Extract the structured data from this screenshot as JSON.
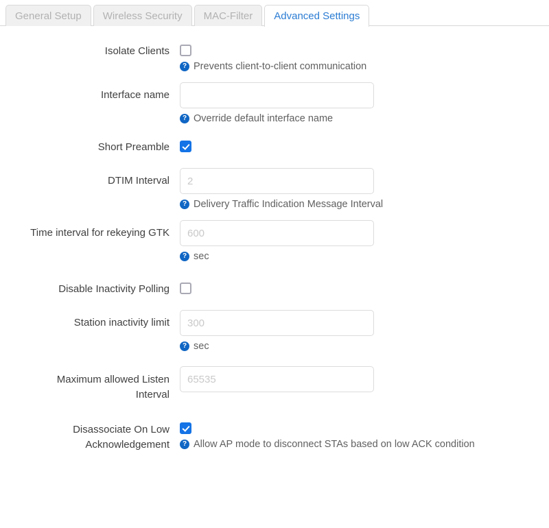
{
  "tabs": [
    {
      "label": "General Setup",
      "active": false
    },
    {
      "label": "Wireless Security",
      "active": false
    },
    {
      "label": "MAC-Filter",
      "active": false
    },
    {
      "label": "Advanced Settings",
      "active": true
    }
  ],
  "help_icon_glyph": "?",
  "fields": {
    "isolate_clients": {
      "label": "Isolate Clients",
      "checked": false,
      "help": "Prevents client-to-client communication"
    },
    "interface_name": {
      "label": "Interface name",
      "value": "",
      "placeholder": "",
      "help": "Override default interface name"
    },
    "short_preamble": {
      "label": "Short Preamble",
      "checked": true,
      "help": ""
    },
    "dtim_interval": {
      "label": "DTIM Interval",
      "value": "",
      "placeholder": "2",
      "help": "Delivery Traffic Indication Message Interval"
    },
    "rekey_gtk": {
      "label": "Time interval for rekeying GTK",
      "value": "",
      "placeholder": "600",
      "help": "sec"
    },
    "disable_inactivity_polling": {
      "label": "Disable Inactivity Polling",
      "checked": false,
      "help": ""
    },
    "station_inactivity_limit": {
      "label": "Station inactivity limit",
      "value": "",
      "placeholder": "300",
      "help": "sec"
    },
    "max_listen_interval": {
      "label_line1": "Maximum allowed Listen",
      "label_line2": "Interval",
      "value": "",
      "placeholder": "65535",
      "help": ""
    },
    "disassoc_low_ack": {
      "label_line1": "Disassociate On Low",
      "label_line2": "Acknowledgement",
      "checked": true,
      "help": "Allow AP mode to disconnect STAs based on low ACK condition"
    }
  },
  "colors": {
    "accent": "#2b7cd3",
    "checkbox_checked": "#1473e6",
    "help_icon": "#1066c4",
    "label_text": "#404040",
    "tab_inactive_text": "#b2b2b2",
    "input_border": "#dcdcdc",
    "placeholder": "#c9c9c9"
  }
}
